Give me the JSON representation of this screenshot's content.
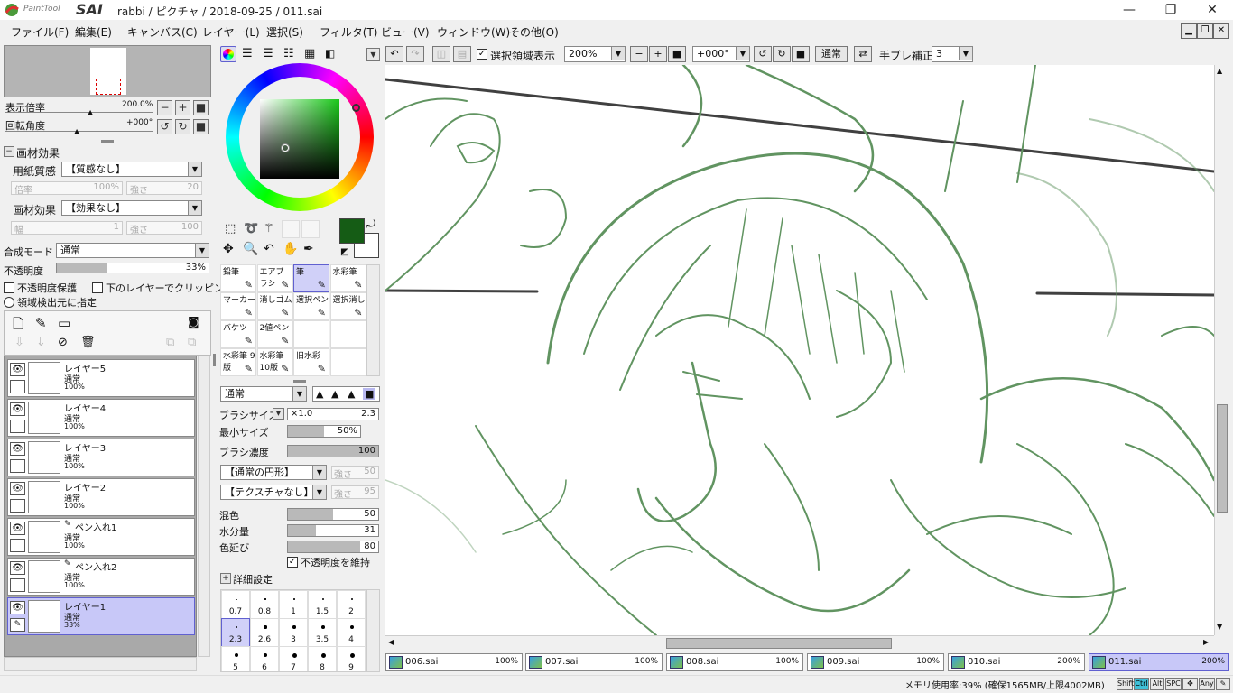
{
  "app": {
    "logo_small": "PaintTool",
    "logo_big": "SAI",
    "title": "rabbi / ピクチャ / 2018-09-25 / 011.sai"
  },
  "window": {
    "minimize": "—",
    "maximize": "❐",
    "close": "✕"
  },
  "menu": [
    "ファイル(F)",
    "編集(E)",
    "キャンバス(C)",
    "レイヤー(L)",
    "選択(S)",
    "フィルタ(T)",
    "ビュー(V)",
    "ウィンドウ(W)",
    "その他(O)"
  ],
  "navigator": {
    "zoom_label": "表示倍率",
    "zoom_value": "200.0%",
    "rotate_label": "回転角度",
    "rotate_value": "+000°"
  },
  "paper": {
    "section": "画材効果",
    "texture_label": "用紙質感",
    "texture_value": "【質感なし】",
    "scale_label": "倍率",
    "scale_value": "100%",
    "strength_label": "強さ",
    "strength_value": "20",
    "effect_label": "画材効果",
    "effect_value": "【効果なし】",
    "width_label": "幅",
    "width_value": "1",
    "strength2_label": "強さ",
    "strength2_value": "100"
  },
  "blend": {
    "label": "合成モード",
    "value": "通常",
    "opacity_label": "不透明度",
    "opacity_value": "33%",
    "opacity_level": 0.33,
    "protect": "不透明度保護",
    "clip": "下のレイヤーでクリッピング",
    "detect": "領域検出元に指定"
  },
  "layers": [
    {
      "name": "レイヤー5",
      "mode": "通常",
      "opacity": "100%",
      "pen": false,
      "selected": false
    },
    {
      "name": "レイヤー4",
      "mode": "通常",
      "opacity": "100%",
      "pen": false,
      "selected": false
    },
    {
      "name": "レイヤー3",
      "mode": "通常",
      "opacity": "100%",
      "pen": false,
      "selected": false
    },
    {
      "name": "レイヤー2",
      "mode": "通常",
      "opacity": "100%",
      "pen": false,
      "selected": false
    },
    {
      "name": "ペン入れ1",
      "mode": "通常",
      "opacity": "100%",
      "pen": true,
      "selected": false
    },
    {
      "name": "ペン入れ2",
      "mode": "通常",
      "opacity": "100%",
      "pen": true,
      "selected": false
    },
    {
      "name": "レイヤー1",
      "mode": "通常",
      "opacity": "33%",
      "pen": false,
      "selected": true
    }
  ],
  "colors": {
    "primary": "#155c15",
    "accent": "#6060d0",
    "select_bg": "#c8c8f8",
    "canvas_line": "#3a7a3a"
  },
  "tools": [
    {
      "label": "鉛筆",
      "sel": false
    },
    {
      "label": "エアブラシ",
      "sel": false
    },
    {
      "label": "筆",
      "sel": true
    },
    {
      "label": "水彩筆",
      "sel": false
    },
    {
      "label": "マーカー",
      "sel": false
    },
    {
      "label": "消しゴム",
      "sel": false
    },
    {
      "label": "選択ペン",
      "sel": false
    },
    {
      "label": "選択消し",
      "sel": false
    },
    {
      "label": "バケツ",
      "sel": false
    },
    {
      "label": "2値ペン",
      "sel": false
    },
    {
      "label": "",
      "sel": false
    },
    {
      "label": "",
      "sel": false
    },
    {
      "label": "水彩筆 9版",
      "sel": false
    },
    {
      "label": "水彩筆 10版",
      "sel": false
    },
    {
      "label": "旧水彩",
      "sel": false
    },
    {
      "label": "",
      "sel": false
    }
  ],
  "brush": {
    "mode": "通常",
    "size_label": "ブラシサイズ",
    "size_mult": "×1.0",
    "size_value": "2.3",
    "min_label": "最小サイズ",
    "min_value": "50%",
    "min_level": 0.5,
    "density_label": "ブラシ濃度",
    "density_value": "100",
    "density_level": 1.0,
    "shape": "【通常の円形】",
    "shape_strength_label": "強さ",
    "shape_strength": "50",
    "texture": "【テクスチャなし】",
    "texture_strength_label": "強さ",
    "texture_strength": "95",
    "mix_label": "混色",
    "mix_value": "50",
    "mix_level": 0.5,
    "water_label": "水分量",
    "water_value": "31",
    "water_level": 0.31,
    "stretch_label": "色延び",
    "stretch_value": "80",
    "stretch_level": 0.8,
    "keep_opacity": "不透明度を維持",
    "advanced": "詳細設定"
  },
  "sizes": [
    "0.7",
    "0.8",
    "1",
    "1.5",
    "2",
    "2.3",
    "2.6",
    "3",
    "3.5",
    "4",
    "5",
    "6",
    "7",
    "8",
    "9"
  ],
  "toolbar": {
    "show_selection": "選択領域表示",
    "zoom": "200%",
    "angle": "+000°",
    "mode": "通常",
    "stabilizer_label": "手ブレ補正",
    "stabilizer_value": "3"
  },
  "files": [
    {
      "name": "006.sai",
      "zoom": "100%",
      "active": false
    },
    {
      "name": "007.sai",
      "zoom": "100%",
      "active": false
    },
    {
      "name": "008.sai",
      "zoom": "100%",
      "active": false
    },
    {
      "name": "009.sai",
      "zoom": "100%",
      "active": false
    },
    {
      "name": "010.sai",
      "zoom": "200%",
      "active": false
    },
    {
      "name": "011.sai",
      "zoom": "200%",
      "active": true
    }
  ],
  "status": {
    "memory": "メモリ使用率:39% (確保1565MB/上限4002MB)",
    "keys": [
      "Shift",
      "Ctrl",
      "Alt",
      "SPC",
      "✥",
      "Any",
      "✎"
    ]
  }
}
